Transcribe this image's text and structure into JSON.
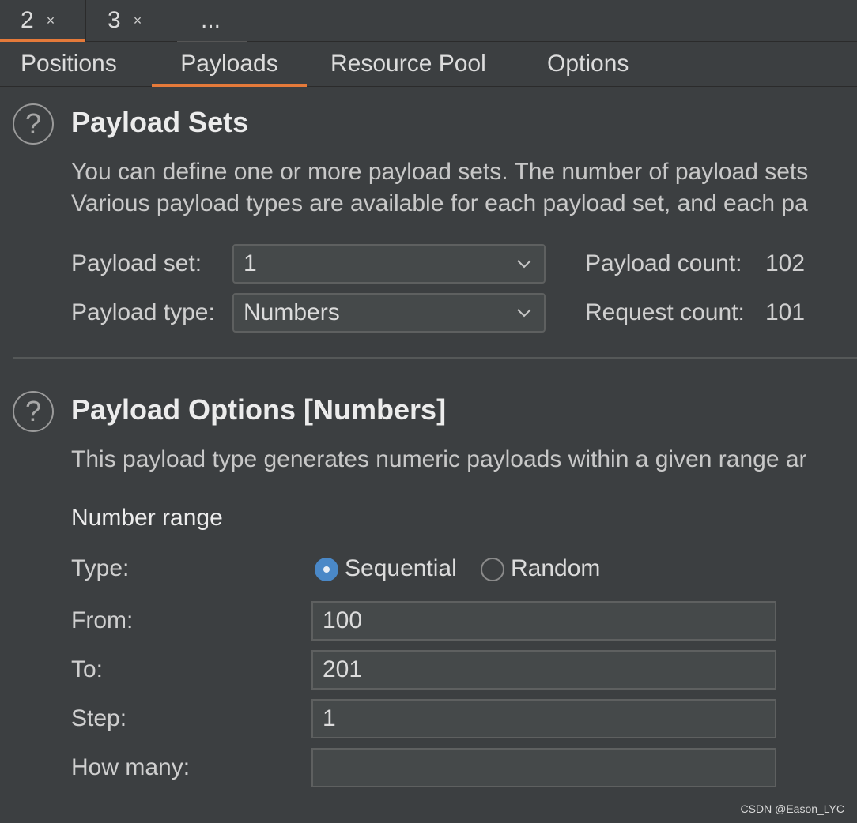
{
  "top_tabs": [
    {
      "label": "2",
      "close": "×"
    },
    {
      "label": "3",
      "close": "×"
    },
    {
      "label": "..."
    }
  ],
  "sub_tabs": [
    "Positions",
    "Payloads",
    "Resource Pool",
    "Options"
  ],
  "payload_sets": {
    "help_icon": "?",
    "title": "Payload Sets",
    "desc_line1": "You can define one or more payload sets. The number of payload sets",
    "desc_line2": "Various payload types are available for each payload set, and each pa",
    "set_label": "Payload set:",
    "set_value": "1",
    "type_label": "Payload type:",
    "type_value": "Numbers",
    "payload_count_label": "Payload count:",
    "payload_count": "102",
    "request_count_label": "Request count:",
    "request_count": "101"
  },
  "payload_options": {
    "help_icon": "?",
    "title": "Payload Options [Numbers]",
    "desc": "This payload type generates numeric payloads within a given range ar",
    "number_range": "Number range",
    "type_label": "Type:",
    "sequential": "Sequential",
    "random": "Random",
    "selected_type": "Sequential",
    "from_label": "From:",
    "from_value": "100",
    "to_label": "To:",
    "to_value": "201",
    "step_label": "Step:",
    "step_value": "1",
    "how_many_label": "How many:",
    "how_many_value": ""
  },
  "watermark": "CSDN @Eason_LYC",
  "colors": {
    "accent": "#e57a3a",
    "radio": "#4a88c7",
    "background": "#3c3f41"
  }
}
